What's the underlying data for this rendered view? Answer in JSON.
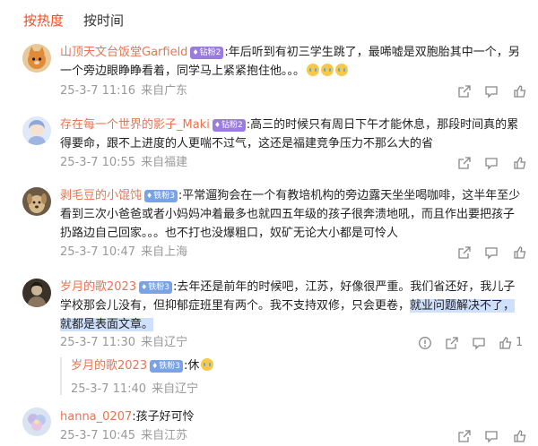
{
  "tabs": {
    "hot": "按热度",
    "time": "按时间"
  },
  "comments": [
    {
      "user": "山顶天文台饭堂Garfield",
      "badge": "钻粉2",
      "badge_color": "#9a7ce0",
      "text": ":年后听到有初三学生跳了，最唏嘘是双胞胎其中一个，另一个旁边眼睁睁看着，同学马上紧紧抱住他。。。",
      "date": "25-3-7 11:16",
      "location": "来自广东",
      "avatar": "cat"
    },
    {
      "user": "存在每一个世界的影子_Maki",
      "badge": "钻粉2",
      "badge_color": "#9a7ce0",
      "text": ":高三的时候只有周日下午才能休息，那段时间真的累得要命，跟不上进度的人更喘不过气，这还是福建竞争压力不那么大的省",
      "date": "25-3-7 10:55",
      "location": "来自福建",
      "avatar": "anime"
    },
    {
      "user": "剥毛豆的小馄饨",
      "badge": "铁粉3",
      "badge_color": "#79a3e6",
      "text": ":平常遛狗会在一个有教培机构的旁边露天坐坐喝咖啡，这半年至少看到三次小爸爸或者小妈妈冲着最多也就四五年级的孩子很奔溃地吼，而且作出要把孩子扔路边自己回家。。。也不打也没爆粗口，奴矿无论大小都是可怜人",
      "date": "25-3-7 10:47",
      "location": "来自上海",
      "avatar": "dog"
    },
    {
      "user": "岁月的歌2023",
      "badge": "铁粉3",
      "badge_color": "#79a3e6",
      "text_a": ":去年还是前年的时候吧，江苏，好像很严重。我们省还好，我儿子学校那会儿没有，但抑郁症班里有两个。我不支持双修，只会更卷，",
      "text_hl": "就业问题解决不了，就都是表面文章。",
      "date": "25-3-7 11:30",
      "location": "来自辽宁",
      "like_count": "1",
      "avatar": "vintage",
      "reply": {
        "user": "岁月的歌2023",
        "badge": "铁粉3",
        "text": ":休",
        "date": "25-3-7 11:40",
        "location": "来自辽宁"
      }
    },
    {
      "user": "hanna_0207",
      "text": ":孩子好可怜",
      "date": "25-3-7 10:45",
      "location": "来自江苏",
      "avatar": "flower"
    }
  ],
  "icons": [
    "share-icon",
    "comment-icon",
    "like-icon",
    "report-icon"
  ],
  "colors": {
    "accent": "#f04e23",
    "username": "#eb7350",
    "meta": "#999999",
    "highlight": "#cfe0ff"
  }
}
